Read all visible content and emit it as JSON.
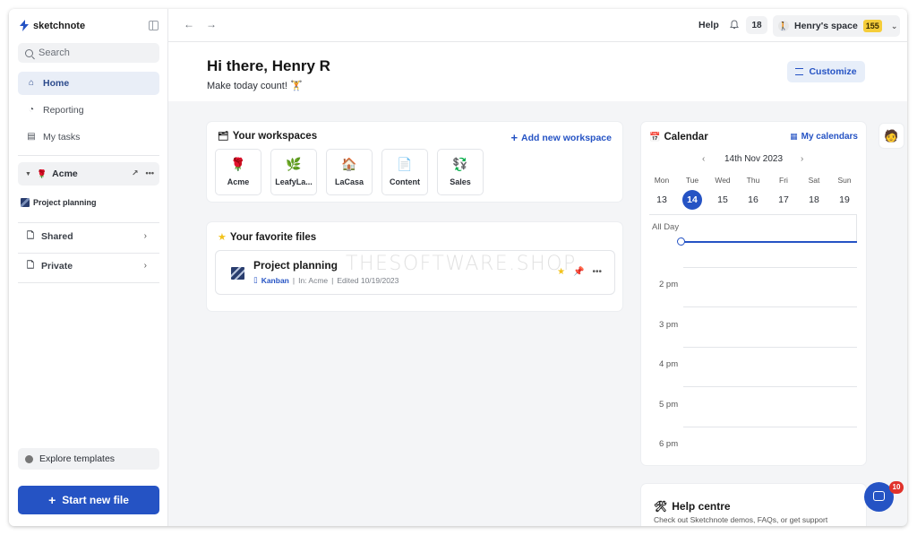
{
  "app": {
    "brand": "sketchnote"
  },
  "sidebar": {
    "search_placeholder": "Search",
    "nav": [
      {
        "label": "Home",
        "icon": "home-icon"
      },
      {
        "label": "Reporting",
        "icon": "chart-pie-icon"
      },
      {
        "label": "My tasks",
        "icon": "clipboard-icon"
      }
    ],
    "workspace": {
      "name": "Acme"
    },
    "project": "Project planning",
    "sections": [
      {
        "label": "Shared"
      },
      {
        "label": "Private"
      }
    ],
    "explore": "Explore templates",
    "start_new_file": "Start new file"
  },
  "topbar": {
    "help": "Help",
    "notifications": "18",
    "space_name": "Henry's space",
    "space_score": "155"
  },
  "header": {
    "greeting": "Hi there, Henry R",
    "subtitle": "Make today count! 🏋",
    "customize": "Customize"
  },
  "workspaces": {
    "title": "Your workspaces",
    "add_link": "Add new workspace",
    "items": [
      {
        "label": "Acme",
        "emoji": "🌹"
      },
      {
        "label": "LeafyLa...",
        "emoji": "🌿"
      },
      {
        "label": "LaCasa",
        "emoji": "🏠"
      },
      {
        "label": "Content",
        "emoji": "📄"
      },
      {
        "label": "Sales",
        "emoji": "💱"
      }
    ]
  },
  "favorites": {
    "title": "Your favorite files",
    "files": [
      {
        "name": "Project planning",
        "type": "Kanban",
        "location": "In: Acme",
        "edited": "Edited 10/19/2023"
      }
    ]
  },
  "calendar": {
    "title": "Calendar",
    "link": "My calendars",
    "month_label": "14th Nov 2023",
    "days": [
      {
        "name": "Mon",
        "date": "13"
      },
      {
        "name": "Tue",
        "date": "14",
        "selected": true
      },
      {
        "name": "Wed",
        "date": "15"
      },
      {
        "name": "Thu",
        "date": "16"
      },
      {
        "name": "Fri",
        "date": "17"
      },
      {
        "name": "Sat",
        "date": "18"
      },
      {
        "name": "Sun",
        "date": "19"
      }
    ],
    "all_day": "All Day",
    "hours": [
      "2 pm",
      "3 pm",
      "4 pm",
      "5 pm",
      "6 pm"
    ]
  },
  "help_centre": {
    "title": "Help centre",
    "subtitle": "Check out Sketchnote demos, FAQs, or get support"
  },
  "chat": {
    "badge": "10"
  },
  "watermark": "THESOFTWARE.SHOP",
  "colors": {
    "accent": "#2553c4",
    "score": "#f5cd3a",
    "badge": "#e0322b"
  }
}
